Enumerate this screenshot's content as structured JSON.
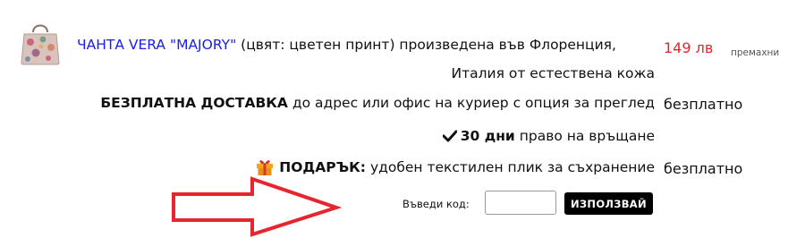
{
  "product": {
    "link_text": "ЧАНТА VERA \"MAJORY\"",
    "desc_line1": " (цвят: цветен принт) произведена във Флоренция,",
    "desc_line2": "Италия от естествена кожа",
    "price": "149 лв",
    "remove_label": "премахни"
  },
  "shipping": {
    "bold": "БЕЗПЛАТНА ДОСТАВКА",
    "rest": " до адрес или офис на куриер с опция за преглед",
    "price": "безплатно"
  },
  "returns": {
    "bold": "30 дни",
    "rest": " право на връщане"
  },
  "gift": {
    "bold": "ПОДАРЪК:",
    "rest": " удобен текстилен плик за съхранение",
    "price": "безплатно"
  },
  "coupon": {
    "label": "Въведи код:",
    "value": "",
    "button_label": "ИЗПОЛЗВАЙ"
  },
  "colors": {
    "link": "#1a20e6",
    "price": "#e8242c",
    "arrow": "#e8242c",
    "button_bg": "#000000",
    "gift_icon": "#f2a51a"
  },
  "icons": {
    "product_thumbnail": "handbag-thumbnail",
    "returns_icon": "checkmark-icon",
    "gift_icon": "gift-icon",
    "annotation": "arrow-right-outline"
  }
}
